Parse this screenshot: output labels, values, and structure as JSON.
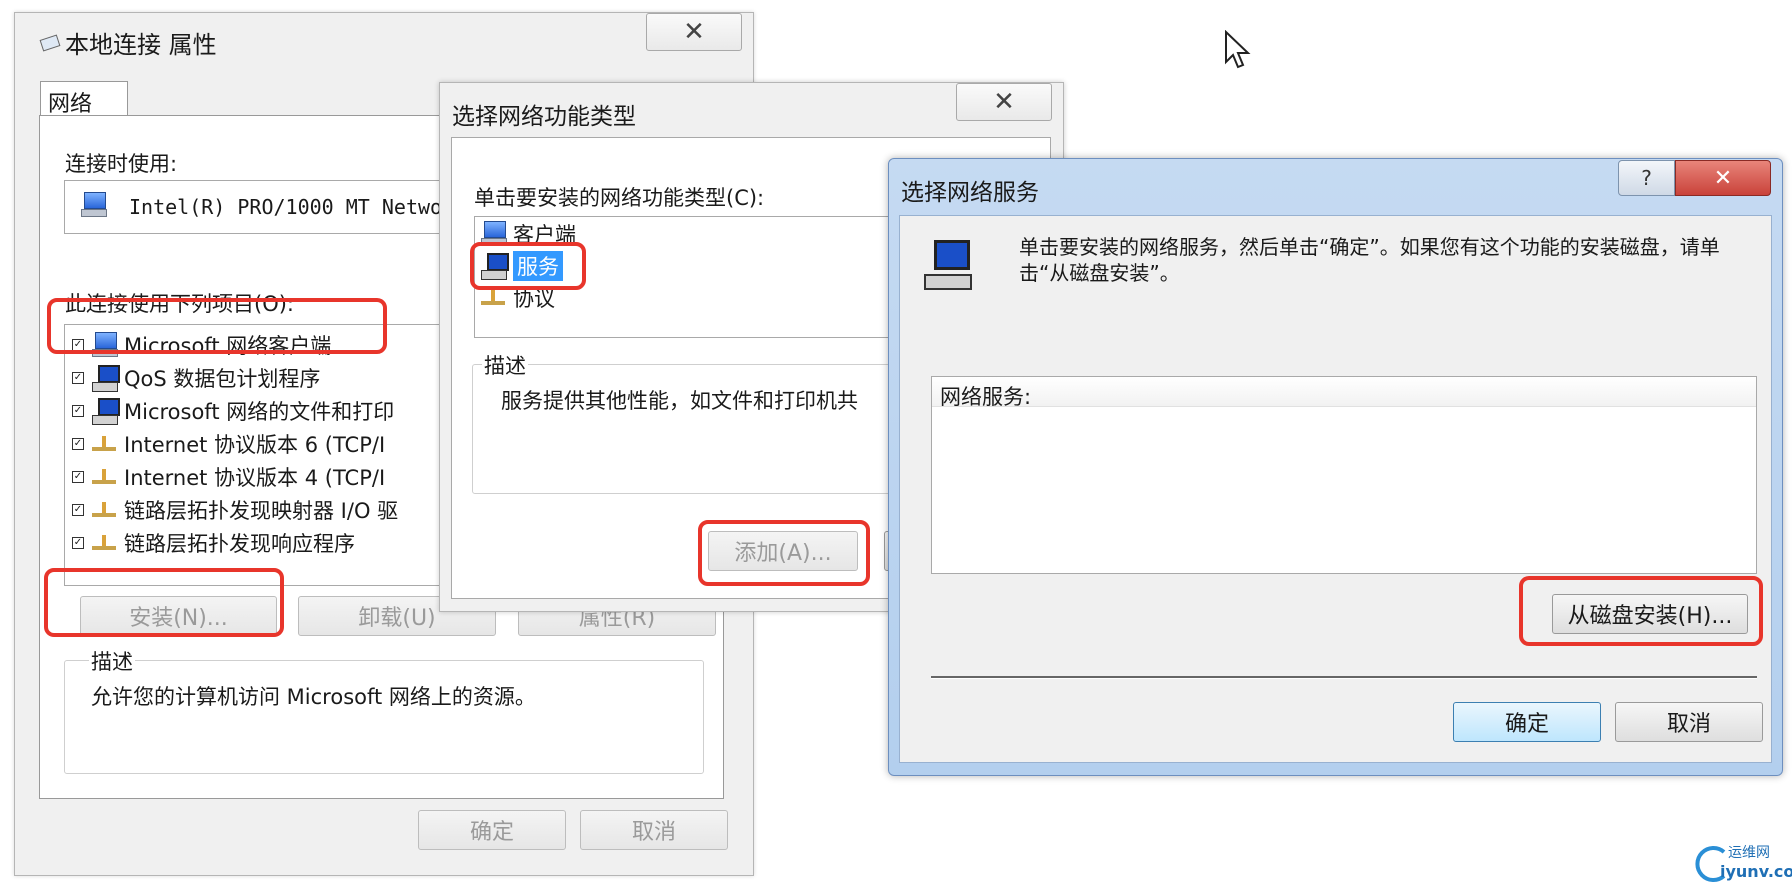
{
  "dialog1": {
    "title": "本地连接 属性",
    "close_glyph": "✕",
    "tab": "网络",
    "connect_using_label": "连接时使用:",
    "adapter_name": "Intel(R) PRO/1000 MT Netwo",
    "items_label": "此连接使用下列项目(O):",
    "items": [
      {
        "label": "Microsoft 网络客户端",
        "checked": true,
        "icon": "network-client-icon"
      },
      {
        "label": "QoS 数据包计划程序",
        "checked": true,
        "icon": "service-computer-icon"
      },
      {
        "label": "Microsoft 网络的文件和打印",
        "checked": true,
        "icon": "service-computer-icon"
      },
      {
        "label": "Internet 协议版本 6 (TCP/I",
        "checked": true,
        "icon": "protocol-icon"
      },
      {
        "label": "Internet 协议版本 4 (TCP/I",
        "checked": true,
        "icon": "protocol-icon"
      },
      {
        "label": "链路层拓扑发现映射器 I/O 驱",
        "checked": true,
        "icon": "protocol-icon"
      },
      {
        "label": "链路层拓扑发现响应程序",
        "checked": true,
        "icon": "protocol-icon"
      }
    ],
    "install_button": "安装(N)...",
    "uninstall_button": "卸载(U)",
    "properties_button": "属性(R)",
    "description_label": "描述",
    "description_text": "允许您的计算机访问 Microsoft 网络上的资源。",
    "ok_button": "确定",
    "cancel_button": "取消"
  },
  "dialog2": {
    "title": "选择网络功能类型",
    "close_glyph": "✕",
    "prompt": "单击要安装的网络功能类型(C):",
    "types": [
      {
        "label": "客户端",
        "icon": "network-client-icon"
      },
      {
        "label": "服务",
        "icon": "service-computer-icon",
        "selected": true
      },
      {
        "label": "协议",
        "icon": "protocol-icon"
      }
    ],
    "description_label": "描述",
    "description_text": "服务提供其他性能，如文件和打印机共",
    "add_button": "添加(A)..."
  },
  "dialog3": {
    "title": "选择网络服务",
    "help_glyph": "?",
    "close_glyph": "✕",
    "instructions": "单击要安装的网络服务，然后单击“确定”。如果您有这个功能的安装磁盘，请单击“从磁盘安装”。",
    "list_header": "网络服务:",
    "have_disk_button": "从磁盘安装(H)...",
    "ok_button": "确定",
    "cancel_button": "取消"
  },
  "watermark": {
    "name": "运维网",
    "url": "iyunv.com"
  },
  "colors": {
    "highlight_red": "#e8352b",
    "selection_blue": "#3399ff",
    "close_red": "#c9423a"
  }
}
